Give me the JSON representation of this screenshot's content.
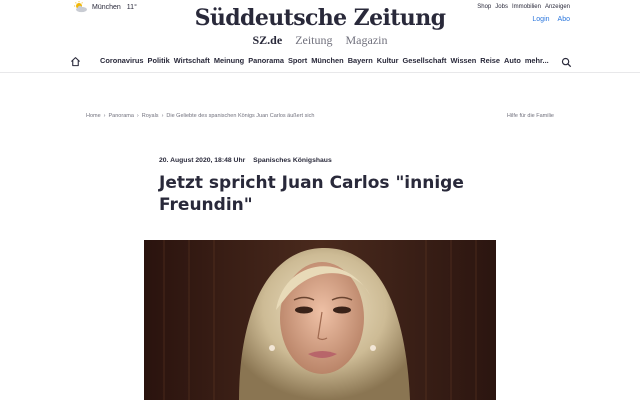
{
  "weather": {
    "city": "München",
    "temp": "11°"
  },
  "header": {
    "logo": "Süddeutsche Zeitung",
    "sublinks": [
      {
        "label": "SZ.de",
        "active": true
      },
      {
        "label": "Zeitung",
        "active": false
      },
      {
        "label": "Magazin",
        "active": false
      }
    ],
    "toplinks": [
      "Shop",
      "Jobs",
      "Immobilien",
      "Anzeigen"
    ],
    "login": "Login",
    "abo": "Abo"
  },
  "nav": {
    "items": [
      "Coronavirus",
      "Politik",
      "Wirtschaft",
      "Meinung",
      "Panorama",
      "Sport",
      "München",
      "Bayern",
      "Kultur",
      "Gesellschaft",
      "Wissen",
      "Reise",
      "Auto",
      "mehr..."
    ]
  },
  "breadcrumb": [
    "Home",
    "Panorama",
    "Royals",
    "Die Geliebte des spanischen Königs Juan Carlos äußert sich"
  ],
  "help_link": "Hilfe für die Familie",
  "article": {
    "date": "20. August 2020, 18:48 Uhr",
    "topic": "Spanisches Königshaus",
    "headline": "Jetzt spricht Juan Carlos \"innige Freundin\""
  },
  "colors": {
    "text": "#29293a",
    "link": "#2a76dd",
    "muted": "#71717d"
  }
}
